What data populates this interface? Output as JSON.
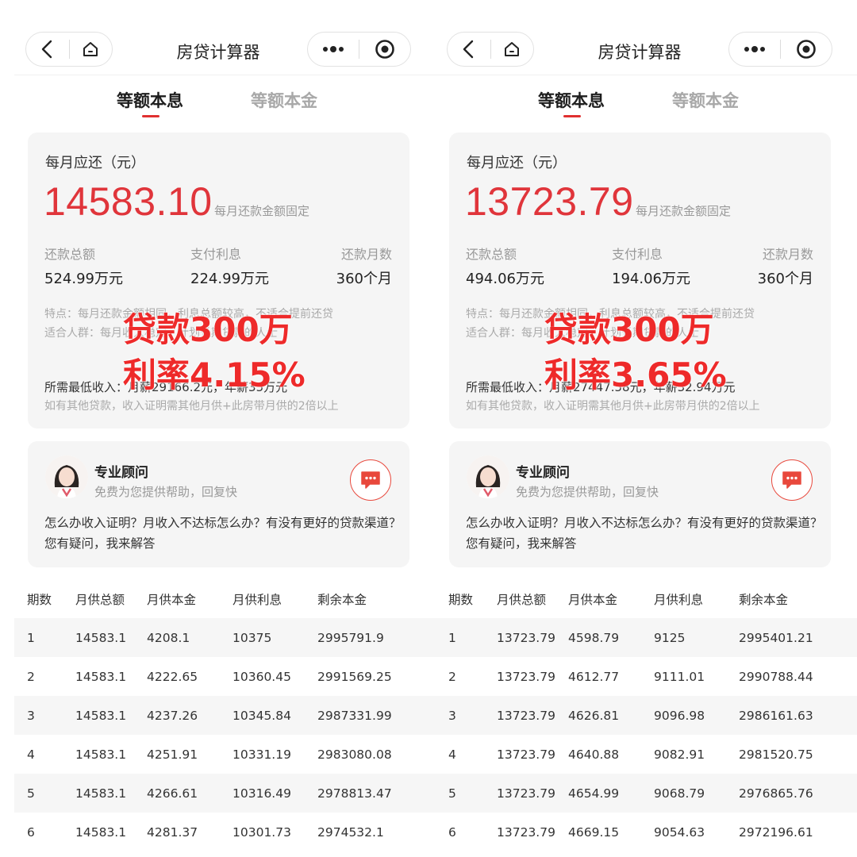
{
  "colors": {
    "accent": "#e0353b",
    "card_bg": "#f5f5f5",
    "muted": "#999999"
  },
  "icons": {
    "back": "chevron-left-icon",
    "home": "home-icon",
    "more": "more-dots-icon",
    "target": "target-icon",
    "chat": "chat-icon"
  },
  "panels": [
    {
      "title": "房贷计算器",
      "tabs": [
        {
          "label": "等额本息"
        },
        {
          "label": "等额本金"
        }
      ],
      "monthly_label": "每月应还（元）",
      "monthly_value": "14583.10",
      "monthly_note": "每月还款金额固定",
      "stats": [
        {
          "label": "还款总额",
          "value": "524.99万元"
        },
        {
          "label": "支付利息",
          "value": "224.99万元"
        },
        {
          "label": "还款月数",
          "value": "360个月"
        }
      ],
      "feature": "特点：每月还款金额相同，利息总额较高，不适合提前还贷",
      "audience": "适合人群：每月收入稳定，计划长期贷款的人士",
      "overlay_amount": "贷款300万",
      "overlay_rate": "利率4.15%",
      "min_income": "所需最低收入：月薪29166.2元，年薪35万元",
      "min_income_note": "如有其他贷款，收入证明需其他月供+此房带月供的2倍以上",
      "advisor": {
        "name": "专业顾问",
        "subtitle": "免费为您提供帮助，回复快",
        "question": "怎么办收入证明？月收入不达标怎么办？有没有更好的贷款渠道？您有疑问，我来解答"
      },
      "table": {
        "headers": [
          "期数",
          "月供总额",
          "月供本金",
          "月供利息",
          "剩余本金"
        ],
        "rows": [
          [
            "1",
            "14583.1",
            "4208.1",
            "10375",
            "2995791.9"
          ],
          [
            "2",
            "14583.1",
            "4222.65",
            "10360.45",
            "2991569.25"
          ],
          [
            "3",
            "14583.1",
            "4237.26",
            "10345.84",
            "2987331.99"
          ],
          [
            "4",
            "14583.1",
            "4251.91",
            "10331.19",
            "2983080.08"
          ],
          [
            "5",
            "14583.1",
            "4266.61",
            "10316.49",
            "2978813.47"
          ],
          [
            "6",
            "14583.1",
            "4281.37",
            "10301.73",
            "2974532.1"
          ]
        ]
      }
    },
    {
      "title": "房贷计算器",
      "tabs": [
        {
          "label": "等额本息"
        },
        {
          "label": "等额本金"
        }
      ],
      "monthly_label": "每月应还（元）",
      "monthly_value": "13723.79",
      "monthly_note": "每月还款金额固定",
      "stats": [
        {
          "label": "还款总额",
          "value": "494.06万元"
        },
        {
          "label": "支付利息",
          "value": "194.06万元"
        },
        {
          "label": "还款月数",
          "value": "360个月"
        }
      ],
      "feature": "特点：每月还款金额相同，利息总额较高，不适合提前还贷",
      "audience": "适合人群：每月收入稳定，计划长期贷款的人士",
      "overlay_amount": "贷款300万",
      "overlay_rate": "利率3.65%",
      "min_income": "所需最低收入：月薪27447.58元，年薪32.94万元",
      "min_income_note": "如有其他贷款，收入证明需其他月供+此房带月供的2倍以上",
      "advisor": {
        "name": "专业顾问",
        "subtitle": "免费为您提供帮助，回复快",
        "question": "怎么办收入证明？月收入不达标怎么办？有没有更好的贷款渠道？您有疑问，我来解答"
      },
      "table": {
        "headers": [
          "期数",
          "月供总额",
          "月供本金",
          "月供利息",
          "剩余本金"
        ],
        "rows": [
          [
            "1",
            "13723.79",
            "4598.79",
            "9125",
            "2995401.21"
          ],
          [
            "2",
            "13723.79",
            "4612.77",
            "9111.01",
            "2990788.44"
          ],
          [
            "3",
            "13723.79",
            "4626.81",
            "9096.98",
            "2986161.63"
          ],
          [
            "4",
            "13723.79",
            "4640.88",
            "9082.91",
            "2981520.75"
          ],
          [
            "5",
            "13723.79",
            "4654.99",
            "9068.79",
            "2976865.76"
          ],
          [
            "6",
            "13723.79",
            "4669.15",
            "9054.63",
            "2972196.61"
          ]
        ]
      }
    }
  ]
}
